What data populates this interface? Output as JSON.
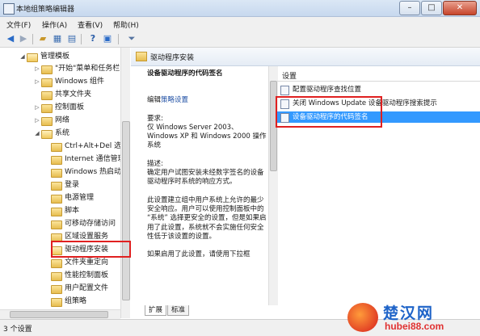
{
  "window": {
    "title": "本地组策略编辑器",
    "buttons": {
      "minimize": "–",
      "maximize": "□",
      "close": "✕"
    }
  },
  "menubar": [
    "文件(F)",
    "操作(A)",
    "查看(V)",
    "帮助(H)"
  ],
  "toolbar": {
    "back_icon": "arrow-left-icon",
    "forward_icon": "arrow-right-icon",
    "folder_icon": "folder-up-icon",
    "tree_icon": "show-tree-icon",
    "export_icon": "export-list-icon",
    "help_icon": "help-icon",
    "properties_icon": "properties-icon",
    "filter_icon": "filter-icon"
  },
  "tree": {
    "items": [
      {
        "label": "管理模板",
        "expanded": true,
        "level": 1
      },
      {
        "label": "\"开始\"菜单和任务栏",
        "expanded": false,
        "level": 2
      },
      {
        "label": "Windows 组件",
        "expanded": false,
        "level": 2
      },
      {
        "label": "共享文件夹",
        "expanded": false,
        "level": 2
      },
      {
        "label": "控制面板",
        "expanded": false,
        "level": 2
      },
      {
        "label": "网络",
        "expanded": false,
        "level": 2
      },
      {
        "label": "系统",
        "expanded": true,
        "level": 2
      },
      {
        "label": "Ctrl+Alt+Del 选项",
        "level": 3
      },
      {
        "label": "Internet 通信管理",
        "level": 3
      },
      {
        "label": "Windows 热启动",
        "level": 3
      },
      {
        "label": "登录",
        "level": 3
      },
      {
        "label": "电源管理",
        "level": 3
      },
      {
        "label": "脚本",
        "level": 3
      },
      {
        "label": "可移动存储访问",
        "level": 3
      },
      {
        "label": "区域设置服务",
        "level": 3
      },
      {
        "label": "驱动程序安装",
        "level": 3,
        "selected": true
      },
      {
        "label": "文件夹重定向",
        "level": 3
      },
      {
        "label": "性能控制面板",
        "level": 3
      },
      {
        "label": "用户配置文件",
        "level": 3
      },
      {
        "label": "组策略",
        "level": 3
      }
    ]
  },
  "right": {
    "header": "驱动程序安装",
    "description": {
      "title": "设备驱动程序的代码签名",
      "edit_prefix": "编辑",
      "edit_link": "策略设置",
      "requirements_label": "要求:",
      "requirements": "仅 Windows Server 2003、Windows XP 和 Windows 2000 操作系统",
      "desc_label": "描述:",
      "desc_text": "确定用户试图安装未经数字签名的设备驱动程序时系统的响应方式。",
      "para2": "此设置建立组中用户系统上允许的最少安全响应。用户可以使用控制面板中的 “系统” 选择更安全的设置，但是如果启用了此设置，系统就不会实施任何安全性低于该设置的设置。",
      "para3": "如果启用了此设置，请使用下拉框"
    },
    "list": {
      "column": "设置",
      "items": [
        "配置驱动程序查找位置",
        "关闭 Windows Update 设备驱动程序搜索提示",
        "设备驱动程序的代码签名"
      ],
      "selected_index": 2
    },
    "tabs": [
      "扩展",
      "标准"
    ]
  },
  "status": "3 个设置",
  "watermark": {
    "name": "楚汉网",
    "url": "hubei88.com"
  }
}
